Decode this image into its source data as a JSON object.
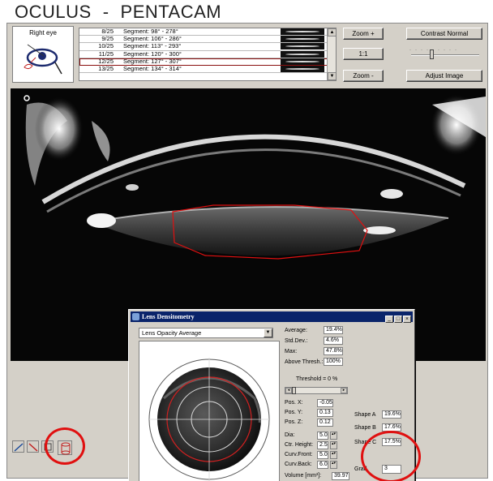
{
  "header": {
    "brand": "OCULUS",
    "separator": "-",
    "product": "PENTACAM"
  },
  "eye": {
    "label": "Right eye"
  },
  "segments": [
    {
      "num": "8/25",
      "text": "Segment: 98° - 278°",
      "selected": false
    },
    {
      "num": "9/25",
      "text": "Segment: 106° - 286°",
      "selected": false
    },
    {
      "num": "10/25",
      "text": "Segment: 113° - 293°",
      "selected": false
    },
    {
      "num": "11/25",
      "text": "Segment: 120° - 300°",
      "selected": false
    },
    {
      "num": "12/25",
      "text": "Segment: 127° - 307°",
      "selected": true
    },
    {
      "num": "13/25",
      "text": "Segment: 134° - 314°",
      "selected": false
    }
  ],
  "buttons": {
    "zoom_in": "Zoom +",
    "one_to_one": "1:1",
    "zoom_out": "Zoom -",
    "contrast": "Contrast Normal",
    "adjust": "Adjust Image"
  },
  "dialog": {
    "title": "Lens Densitometry",
    "mode": "Lens Opacity Average",
    "stats": [
      {
        "label": "Average:",
        "value": "19.4%"
      },
      {
        "label": "Std.Dev.:",
        "value": "4.6%"
      },
      {
        "label": "Max:",
        "value": "47.8%"
      },
      {
        "label": "Above Thresh.:",
        "value": "100%"
      }
    ],
    "threshold_label": "Threshold = 0 %",
    "threshold_value": 0,
    "pos": [
      {
        "label": "Pos. X:",
        "value": "-0.05"
      },
      {
        "label": "Pos. Y:",
        "value": "0.13"
      },
      {
        "label": "Pos. Z:",
        "value": "0.12"
      }
    ],
    "geometry": [
      {
        "label": "Dia:",
        "value": "5.0"
      },
      {
        "label": "Ctr. Height:",
        "value": "2.5"
      },
      {
        "label": "Curv.Front:",
        "value": "5.0"
      },
      {
        "label": "Curv.Back:",
        "value": "6.0"
      }
    ],
    "volume": {
      "label": "Volume [mm³]:",
      "value": "39.97"
    },
    "shapes": [
      {
        "label": "Shape A",
        "value": "19.6%"
      },
      {
        "label": "Shape B",
        "value": "17.6%"
      },
      {
        "label": "Shape C",
        "value": "17.5%"
      }
    ],
    "grade": {
      "label": "Grad",
      "value": "3"
    }
  },
  "colors": {
    "highlight": "#e01010",
    "dialog_titlebar": "#0a246a",
    "window_bg": "#d4d0c8"
  }
}
